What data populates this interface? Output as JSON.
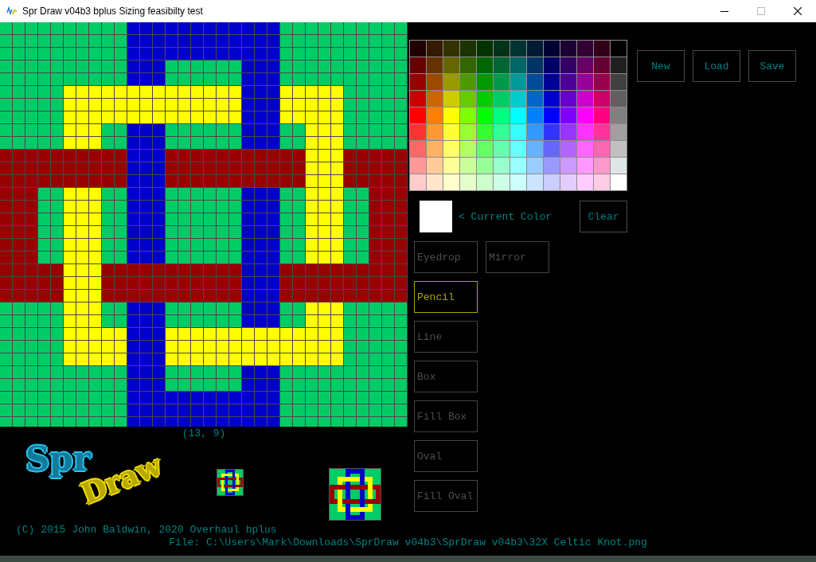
{
  "window": {
    "title": "Spr Draw v04b3 bplus Sizing feasibilty test"
  },
  "palette": [
    {
      "swatches": [
        {
          "color": "#200000"
        },
        {
          "color": "#331a00"
        },
        {
          "color": "#333300"
        },
        {
          "color": "#1a3300"
        },
        {
          "color": "#003300"
        },
        {
          "color": "#00331a"
        },
        {
          "color": "#003333"
        },
        {
          "color": "#001a33"
        },
        {
          "color": "#000033"
        },
        {
          "color": "#1a0033"
        },
        {
          "color": "#330033"
        },
        {
          "color": "#33001a"
        },
        {
          "color": "#000000"
        }
      ]
    },
    {
      "swatches": [
        {
          "color": "#660000"
        },
        {
          "color": "#663300"
        },
        {
          "color": "#666600"
        },
        {
          "color": "#336600"
        },
        {
          "color": "#006600"
        },
        {
          "color": "#006633"
        },
        {
          "color": "#006666"
        },
        {
          "color": "#003366"
        },
        {
          "color": "#000066"
        },
        {
          "color": "#330066"
        },
        {
          "color": "#660066"
        },
        {
          "color": "#660033"
        },
        {
          "color": "#202020"
        }
      ]
    },
    {
      "swatches": [
        {
          "color": "#990000"
        },
        {
          "color": "#994c00"
        },
        {
          "color": "#999900"
        },
        {
          "color": "#4c9900"
        },
        {
          "color": "#009900"
        },
        {
          "color": "#00994c"
        },
        {
          "color": "#009999"
        },
        {
          "color": "#004c99"
        },
        {
          "color": "#000099"
        },
        {
          "color": "#4c0099"
        },
        {
          "color": "#990099"
        },
        {
          "color": "#99004c"
        },
        {
          "color": "#404040"
        }
      ]
    },
    {
      "swatches": [
        {
          "color": "#cc0000"
        },
        {
          "color": "#cc6600"
        },
        {
          "color": "#cccc00"
        },
        {
          "color": "#66cc00"
        },
        {
          "color": "#00cc00"
        },
        {
          "color": "#00cc66"
        },
        {
          "color": "#00cccc"
        },
        {
          "color": "#0066cc"
        },
        {
          "color": "#0000cc"
        },
        {
          "color": "#6600cc"
        },
        {
          "color": "#cc00cc"
        },
        {
          "color": "#cc0066"
        },
        {
          "color": "#606060"
        }
      ]
    },
    {
      "swatches": [
        {
          "color": "#ff0000"
        },
        {
          "color": "#ff8000"
        },
        {
          "color": "#ffff00"
        },
        {
          "color": "#80ff00"
        },
        {
          "color": "#00ff00"
        },
        {
          "color": "#00ff80"
        },
        {
          "color": "#00ffff"
        },
        {
          "color": "#0080ff"
        },
        {
          "color": "#0000ff"
        },
        {
          "color": "#8000ff"
        },
        {
          "color": "#ff00ff"
        },
        {
          "color": "#ff0080"
        },
        {
          "color": "#808080"
        }
      ]
    },
    {
      "swatches": [
        {
          "color": "#ff3333"
        },
        {
          "color": "#ff9933"
        },
        {
          "color": "#ffff33"
        },
        {
          "color": "#99ff33"
        },
        {
          "color": "#33ff33"
        },
        {
          "color": "#33ff99"
        },
        {
          "color": "#33ffff"
        },
        {
          "color": "#3399ff"
        },
        {
          "color": "#3333ff"
        },
        {
          "color": "#9933ff"
        },
        {
          "color": "#ff33ff"
        },
        {
          "color": "#ff3399"
        },
        {
          "color": "#a0a0a0"
        }
      ]
    },
    {
      "swatches": [
        {
          "color": "#ff6666"
        },
        {
          "color": "#ffb266"
        },
        {
          "color": "#ffff66"
        },
        {
          "color": "#b2ff66"
        },
        {
          "color": "#66ff66"
        },
        {
          "color": "#66ffb2"
        },
        {
          "color": "#66ffff"
        },
        {
          "color": "#66b2ff"
        },
        {
          "color": "#6666ff"
        },
        {
          "color": "#b266ff"
        },
        {
          "color": "#ff66ff"
        },
        {
          "color": "#ff66b2"
        },
        {
          "color": "#c0c0c0"
        }
      ]
    },
    {
      "swatches": [
        {
          "color": "#ff9999"
        },
        {
          "color": "#ffcc99"
        },
        {
          "color": "#ffff99"
        },
        {
          "color": "#ccff99"
        },
        {
          "color": "#99ff99"
        },
        {
          "color": "#99ffcc"
        },
        {
          "color": "#99ffff"
        },
        {
          "color": "#99ccff"
        },
        {
          "color": "#9999ff"
        },
        {
          "color": "#cc99ff"
        },
        {
          "color": "#ff99ff"
        },
        {
          "color": "#ff99cc"
        },
        {
          "color": "#e0e6e8"
        }
      ]
    },
    {
      "swatches": [
        {
          "color": "#ffcccc"
        },
        {
          "color": "#ffe5cc"
        },
        {
          "color": "#ffffcc"
        },
        {
          "color": "#e5ffcc"
        },
        {
          "color": "#ccffcc"
        },
        {
          "color": "#ccffe5"
        },
        {
          "color": "#ccffff"
        },
        {
          "color": "#cce5ff"
        },
        {
          "color": "#ccccff"
        },
        {
          "color": "#e5ccff"
        },
        {
          "color": "#ffccff"
        },
        {
          "color": "#ffcce5"
        },
        {
          "color": "#ffffff"
        }
      ]
    }
  ],
  "file_buttons": [
    {
      "label": "New"
    },
    {
      "label": "Load"
    },
    {
      "label": "Save"
    }
  ],
  "current_color": {
    "color": "#ffffff",
    "label": "< Current Color"
  },
  "clear_button": {
    "label": "Clear"
  },
  "tools": [
    {
      "label": "Eyedrop",
      "selected": false
    },
    {
      "label": "Pencil",
      "selected": true
    },
    {
      "label": "Line",
      "selected": false
    },
    {
      "label": "Box",
      "selected": false
    },
    {
      "label": "Fill Box",
      "selected": false
    },
    {
      "label": "Oval",
      "selected": false
    },
    {
      "label": "Fill Oval",
      "selected": false
    }
  ],
  "mirror": {
    "label": "Mirror",
    "on": false
  },
  "cursor_position": "(13, 9)",
  "logo": {
    "line_1": "Spr",
    "line_2": "Draw"
  },
  "copyright": "(C) 2015 John Baldwin, 2020 Overhaul bplus",
  "file_path": "File: C:\\Users\\Mark\\Downloads\\SprDraw v04b3\\SprDraw v04b3\\32X Celtic Knot.png"
}
